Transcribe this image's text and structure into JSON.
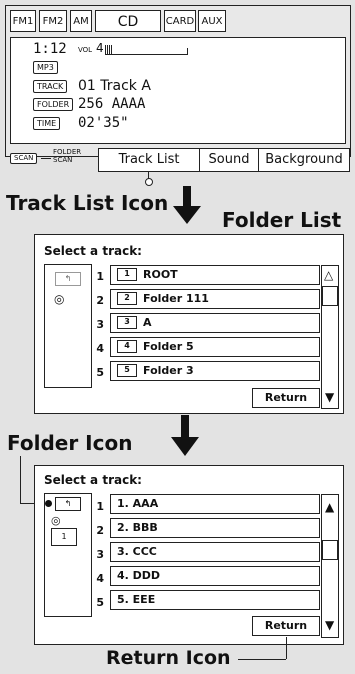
{
  "tabs": [
    {
      "label": "FM1",
      "active": false
    },
    {
      "label": "FM2",
      "active": false
    },
    {
      "label": "AM",
      "active": false
    },
    {
      "label": "CD",
      "active": true
    },
    {
      "label": "CARD",
      "active": false
    },
    {
      "label": "AUX",
      "active": false
    }
  ],
  "display": {
    "time": "1:12",
    "vol_label": "VOL",
    "vol_value": "4",
    "format": "MP3",
    "track_tag": "TRACK",
    "track_value": "01 Track A",
    "folder_tag": "FOLDER",
    "folder_value": "256 AAAA",
    "time_tag": "TIME",
    "time_value": "02'35\""
  },
  "bottom_bar": {
    "scan": "SCAN",
    "folder_scan": "FOLDER\nSCAN",
    "track_list": "Track List",
    "sound": "Sound",
    "background": "Background"
  },
  "callouts": {
    "track_list_icon": "Track List Icon",
    "folder_list": "Folder List",
    "folder_icon": "Folder Icon",
    "return_icon": "Return Icon"
  },
  "screen1": {
    "heading": "Select a track:",
    "rows": [
      {
        "num": "1",
        "icon": "1",
        "label": "ROOT"
      },
      {
        "num": "2",
        "icon": "2",
        "label": "Folder 111"
      },
      {
        "num": "3",
        "icon": "3",
        "label": "A"
      },
      {
        "num": "4",
        "icon": "4",
        "label": "Folder 5"
      },
      {
        "num": "5",
        "icon": "5",
        "label": "Folder 3"
      }
    ],
    "return": "Return",
    "up_arrow": "△",
    "down_arrow": "▼"
  },
  "screen2": {
    "heading": "Select a track:",
    "rows": [
      {
        "num": "1",
        "label": "1. AAA"
      },
      {
        "num": "2",
        "label": "2. BBB"
      },
      {
        "num": "3",
        "label": "3. CCC"
      },
      {
        "num": "4",
        "label": "4. DDD"
      },
      {
        "num": "5",
        "label": "5. EEE"
      }
    ],
    "return": "Return",
    "up_arrow": "▲",
    "down_arrow": "▼"
  }
}
